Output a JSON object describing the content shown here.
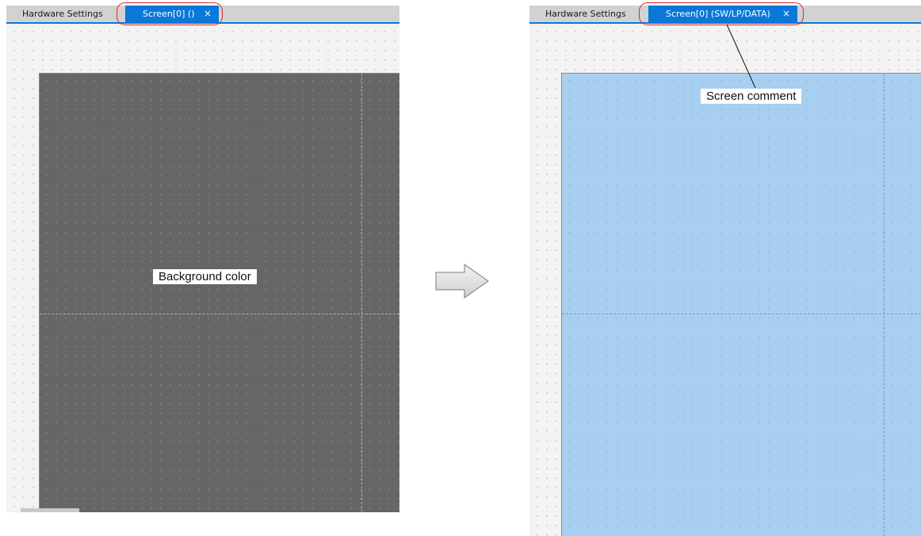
{
  "left_panel": {
    "tabs": [
      {
        "label": "Hardware Settings",
        "active": false
      },
      {
        "label": "Screen[0] ()",
        "active": true
      }
    ],
    "close_glyph": "×",
    "annotation": "Background color",
    "canvas_color": "#666666"
  },
  "right_panel": {
    "tabs": [
      {
        "label": "Hardware Settings",
        "active": false
      },
      {
        "label": "Screen[0] (SW/LP/DATA)",
        "active": true
      }
    ],
    "close_glyph": "×",
    "annotation": "Screen comment",
    "canvas_color": "#a8cfef"
  },
  "colors": {
    "tab_active": "#0a78d7",
    "highlight": "#d9262b",
    "workspace": "#f3f3f3"
  },
  "icons": {
    "transition_arrow": "right-arrow-icon",
    "close": "close-icon"
  }
}
